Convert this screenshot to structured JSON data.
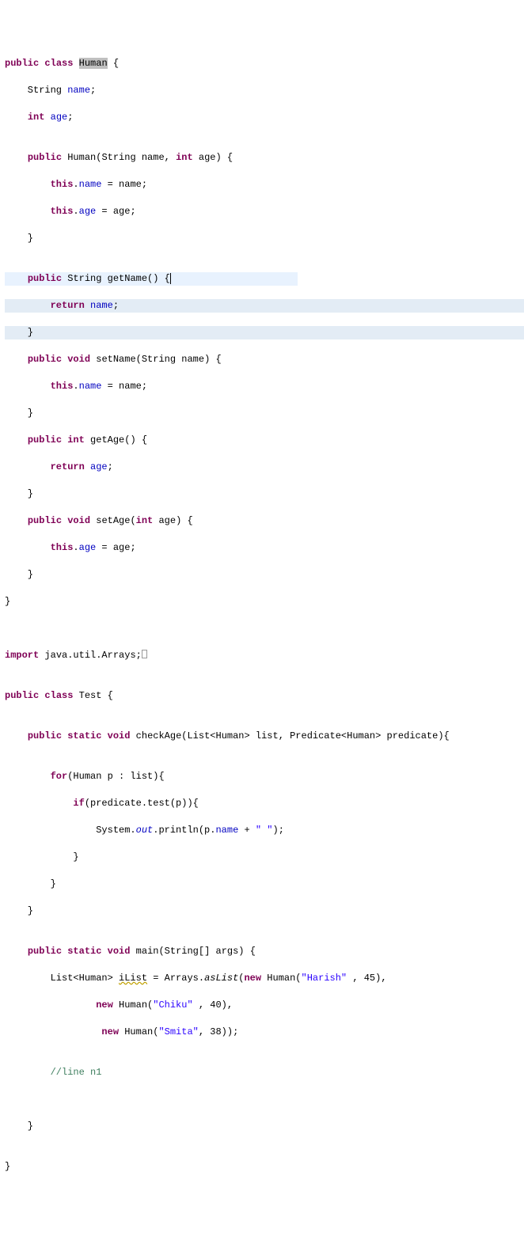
{
  "code": {
    "l1_kw1": "public",
    "l1_kw2": "class",
    "l1_cls": "Human",
    "l1_brace": " {",
    "l2": "    String ",
    "l2_field": "name",
    "l2_semi": ";",
    "l3_a": "    ",
    "l3_kw": "int",
    "l3_b": " ",
    "l3_field": "age",
    "l3_semi": ";",
    "l4": "",
    "l5_a": "    ",
    "l5_kw": "public",
    "l5_b": " Human(String name, ",
    "l5_kw2": "int",
    "l5_c": " age) {",
    "l6_a": "        ",
    "l6_kw": "this",
    "l6_b": ".",
    "l6_field": "name",
    "l6_c": " = name;",
    "l7_a": "        ",
    "l7_kw": "this",
    "l7_b": ".",
    "l7_field": "age",
    "l7_c": " = age;",
    "l8": "    }",
    "l9": "",
    "l10_a": "    ",
    "l10_kw": "public",
    "l10_b": " String getName() {",
    "l11_a": "        ",
    "l11_kw": "return",
    "l11_b": " ",
    "l11_field": "name",
    "l11_c": ";",
    "l12": "    }",
    "l13_a": "    ",
    "l13_kw": "public",
    "l13_kw2": " void",
    "l13_b": " setName(String name) {",
    "l14_a": "        ",
    "l14_kw": "this",
    "l14_b": ".",
    "l14_field": "name",
    "l14_c": " = name;",
    "l15": "    }",
    "l16_a": "    ",
    "l16_kw": "public",
    "l16_b": " ",
    "l16_kw2": "int",
    "l16_c": " getAge() {",
    "l17_a": "        ",
    "l17_kw": "return",
    "l17_b": " ",
    "l17_field": "age",
    "l17_c": ";",
    "l18": "    }",
    "l19_a": "    ",
    "l19_kw": "public",
    "l19_kw2": " void",
    "l19_b": " setAge(",
    "l19_kw3": "int",
    "l19_c": " age) {",
    "l20_a": "        ",
    "l20_kw": "this",
    "l20_b": ".",
    "l20_field": "age",
    "l20_c": " = age;",
    "l21": "    }",
    "l22": "}",
    "l23": "",
    "l24": "",
    "l25_kw": "import",
    "l25_b": " java.util.Arrays;",
    "l26": "",
    "l27_kw1": "public",
    "l27_kw2": " class",
    "l27_b": " Test {",
    "l28": "",
    "l29_a": "    ",
    "l29_kw1": "public",
    "l29_kw2": " static",
    "l29_kw3": " void",
    "l29_b": " checkAge(List<Human> list, Predicate<Human> predicate){",
    "l30": "",
    "l31_a": "        ",
    "l31_kw": "for",
    "l31_b": "(Human p : list){",
    "l32_a": "            ",
    "l32_kw": "if",
    "l32_b": "(predicate.test(p)){",
    "l33_a": "                System.",
    "l33_sf": "out",
    "l33_b": ".println(p.",
    "l33_f": "name",
    "l33_c": " + ",
    "l33_str": "\" \"",
    "l33_d": ");",
    "l34": "            }",
    "l35": "        }",
    "l36": "    }",
    "l37": "",
    "l38_a": "    ",
    "l38_kw1": "public",
    "l38_kw2": " static",
    "l38_kw3": " void",
    "l38_b": " main(String[] args) {",
    "l39_a": "        List<Human> ",
    "l39_var": "iList",
    "l39_b": " = Arrays.",
    "l39_m": "asList",
    "l39_c": "(",
    "l39_kw": "new",
    "l39_d": " Human(",
    "l39_str": "\"Harish\"",
    "l39_e": " , 45),",
    "l40_a": "                ",
    "l40_kw": "new",
    "l40_b": " Human(",
    "l40_str": "\"Chiku\"",
    "l40_c": " , 40),",
    "l41_a": "                 ",
    "l41_kw": "new",
    "l41_b": " Human(",
    "l41_str": "\"Smita\"",
    "l41_c": ", 38));",
    "l42": "",
    "l43_a": "        ",
    "l43_com": "//line n1",
    "l44": "",
    "l45": "    }",
    "l46": "",
    "l47": "}"
  }
}
